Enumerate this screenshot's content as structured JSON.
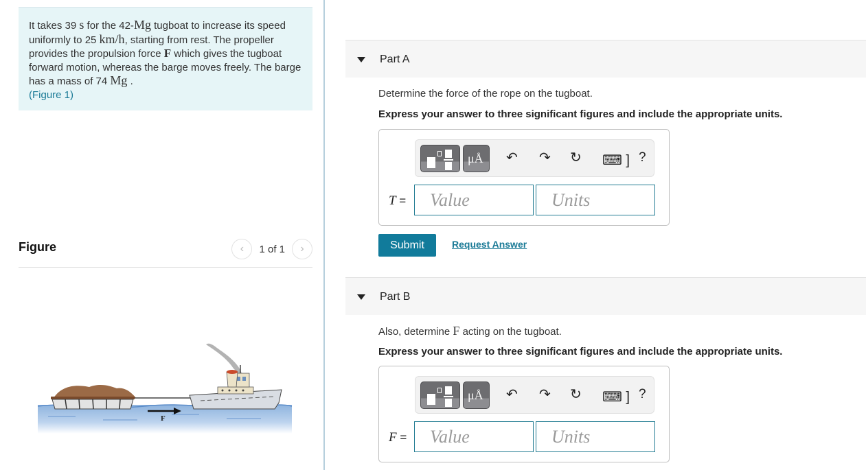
{
  "problem": {
    "segments": [
      {
        "t": "It takes 39 ",
        "k": "txt"
      },
      {
        "t": "s",
        "k": "m"
      },
      {
        "t": " for the 42-",
        "k": "txt"
      },
      {
        "t": "Mg",
        "k": "m"
      },
      {
        "t": " tugboat to increase its speed uniformly to 25 ",
        "k": "txt"
      },
      {
        "t": "km/h",
        "k": "m"
      },
      {
        "t": ", starting from rest. The propeller provides the propulsion force ",
        "k": "txt"
      },
      {
        "t": "F",
        "k": "mb"
      },
      {
        "t": " which gives the tugboat forward motion, whereas the barge moves freely. The barge has a mass of 74 ",
        "k": "txt"
      },
      {
        "t": "Mg",
        "k": "m"
      },
      {
        "t": " .",
        "k": "txt"
      }
    ],
    "figure_link": "(Figure 1)"
  },
  "figure": {
    "title": "Figure",
    "pager_text": "1 of 1",
    "prev_icon": "chevron-left-icon",
    "next_icon": "chevron-right-icon",
    "force_label": "F"
  },
  "parts": [
    {
      "label": "Part A",
      "question_prefix": "Determine the force of the rope on the tugboat.",
      "instruction": "Express your answer to three significant figures and include the appropriate units.",
      "variable": "T",
      "value_placeholder": "Value",
      "units_placeholder": "Units",
      "value": "",
      "units": ""
    },
    {
      "label": "Part B",
      "question_prefix": "Also, determine ",
      "question_symbol": "F",
      "question_suffix": " acting on the tugboat.",
      "instruction": "Express your answer to three significant figures and include the appropriate units.",
      "variable": "F",
      "value_placeholder": "Value",
      "units_placeholder": "Units",
      "value": "",
      "units": ""
    }
  ],
  "toolbar": {
    "units_glyph": "μÅ",
    "undo": "↶",
    "redo": "↷",
    "reset": "↻",
    "keyboard": "⌨ ]",
    "help": "?"
  },
  "actions": {
    "submit_label": "Submit",
    "request_answer_label": "Request Answer"
  },
  "colors": {
    "accent": "#117b9b",
    "problem_bg": "#e6f5f7",
    "input_border": "#1f7a91"
  }
}
